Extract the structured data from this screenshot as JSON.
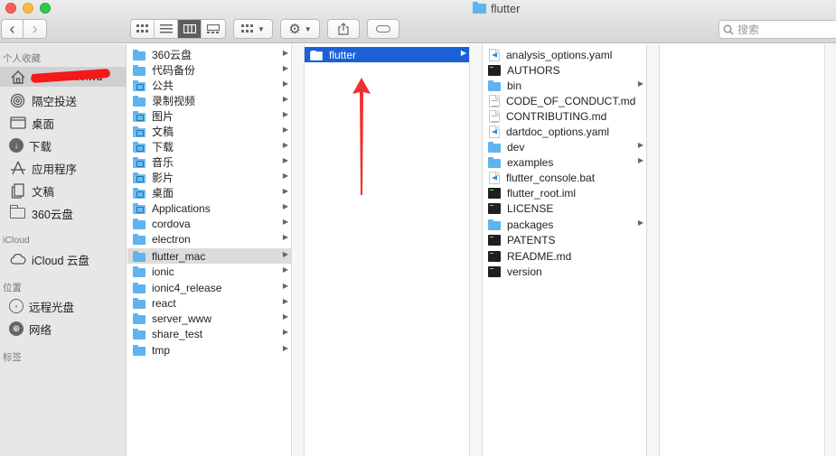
{
  "window": {
    "title": "flutter"
  },
  "toolbar": {
    "back": "‹",
    "forward": "›",
    "views": [
      "icon-view",
      "list-view",
      "column-view",
      "gallery-view"
    ],
    "active_view": "column-view",
    "search_placeholder": "搜索"
  },
  "sidebar": {
    "favorites_title": "个人收藏",
    "favorites": [
      {
        "label": "xxxxxxxxxxwu",
        "icon": "home-icon"
      },
      {
        "label": "隔空投送",
        "icon": "airdrop-icon"
      },
      {
        "label": "桌面",
        "icon": "desktop-icon"
      },
      {
        "label": "下载",
        "icon": "download-icon"
      },
      {
        "label": "应用程序",
        "icon": "applications-icon"
      },
      {
        "label": "文稿",
        "icon": "document-icon"
      },
      {
        "label": "360云盘",
        "icon": "folder-icon"
      }
    ],
    "icloud_title": "iCloud",
    "icloud": [
      {
        "label": "iCloud 云盘",
        "icon": "cloud-icon"
      }
    ],
    "locations_title": "位置",
    "locations": [
      {
        "label": "远程光盘",
        "icon": "disc-icon"
      },
      {
        "label": "网络",
        "icon": "network-icon"
      }
    ],
    "tags_title": "标签"
  },
  "column1": [
    {
      "label": "360云盘",
      "icon": "folder-icon"
    },
    {
      "label": "代码备份",
      "icon": "folder-icon"
    },
    {
      "label": "公共",
      "icon": "folder-icon"
    },
    {
      "label": "录制视频",
      "icon": "folder-icon"
    },
    {
      "label": "图片",
      "icon": "folder-icon"
    },
    {
      "label": "文稿",
      "icon": "folder-icon"
    },
    {
      "label": "下载",
      "icon": "folder-icon"
    },
    {
      "label": "音乐",
      "icon": "folder-icon"
    },
    {
      "label": "影片",
      "icon": "folder-icon"
    },
    {
      "label": "桌面",
      "icon": "folder-icon"
    },
    {
      "label": "Applications",
      "icon": "folder-icon"
    },
    {
      "label": "cordova",
      "icon": "folder-icon"
    },
    {
      "label": "electron",
      "icon": "folder-icon"
    },
    {
      "label": "flutter_mac",
      "icon": "folder-icon"
    },
    {
      "label": "ionic",
      "icon": "folder-icon"
    },
    {
      "label": "ionic4_release",
      "icon": "folder-icon"
    },
    {
      "label": "react",
      "icon": "folder-icon"
    },
    {
      "label": "server_www",
      "icon": "folder-icon"
    },
    {
      "label": "share_test",
      "icon": "folder-icon"
    },
    {
      "label": "tmp",
      "icon": "folder-icon"
    }
  ],
  "column2": [
    {
      "label": "flutter",
      "icon": "folder-icon"
    }
  ],
  "column3": [
    {
      "label": "analysis_options.yaml",
      "icon": "vscode-file-icon"
    },
    {
      "label": "AUTHORS",
      "icon": "executable-icon"
    },
    {
      "label": "bin",
      "icon": "folder-icon"
    },
    {
      "label": "CODE_OF_CONDUCT.md",
      "icon": "markdown-file-icon"
    },
    {
      "label": "CONTRIBUTING.md",
      "icon": "markdown-file-icon"
    },
    {
      "label": "dartdoc_options.yaml",
      "icon": "vscode-file-icon"
    },
    {
      "label": "dev",
      "icon": "folder-icon"
    },
    {
      "label": "examples",
      "icon": "folder-icon"
    },
    {
      "label": "flutter_console.bat",
      "icon": "vscode-file-icon"
    },
    {
      "label": "flutter_root.iml",
      "icon": "executable-icon"
    },
    {
      "label": "LICENSE",
      "icon": "executable-icon"
    },
    {
      "label": "packages",
      "icon": "folder-icon"
    },
    {
      "label": "PATENTS",
      "icon": "executable-icon"
    },
    {
      "label": "README.md",
      "icon": "markdown-file-icon"
    },
    {
      "label": "version",
      "icon": "executable-icon"
    }
  ],
  "colors": {
    "selection_blue": "#1a61d8",
    "folder_blue": "#5fb3ee",
    "annotation_red": "#f0302e"
  }
}
